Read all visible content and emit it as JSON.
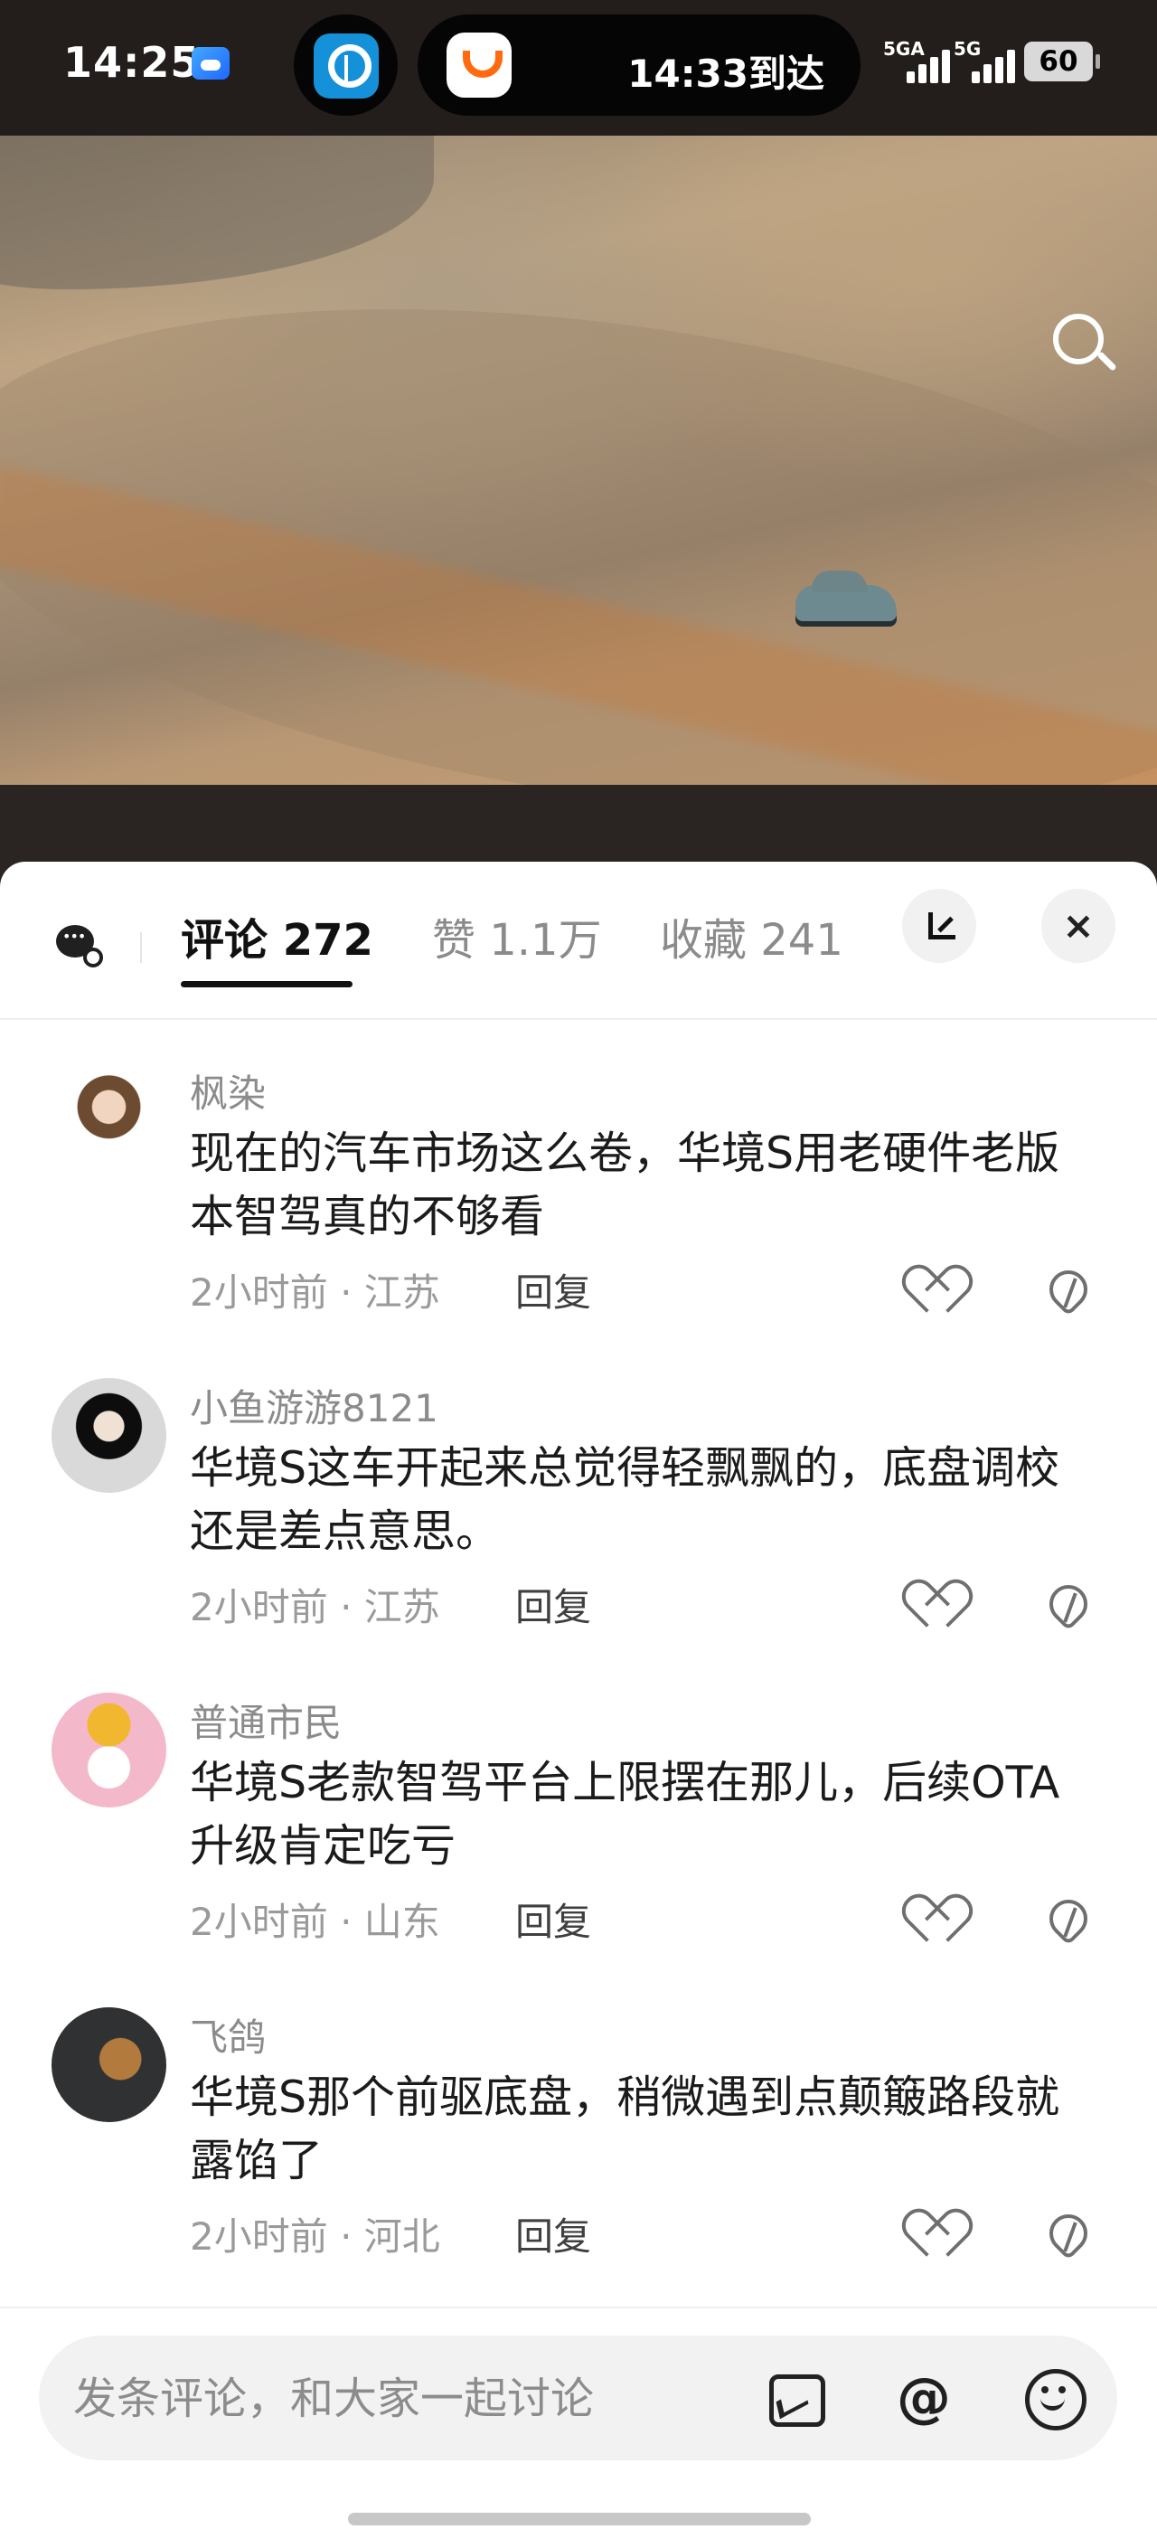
{
  "status_bar": {
    "time": "14:25",
    "arrival": "14:33到达",
    "network_1": "5GA",
    "network_2": "5G",
    "battery": "60",
    "icons": [
      "weather-icon",
      "railway-app-icon",
      "didi-app-icon",
      "signal-icon",
      "battery-icon"
    ]
  },
  "video": {
    "icons": [
      "search-icon"
    ]
  },
  "comment_panel": {
    "tabs": [
      {
        "label": "评论 272",
        "active": true
      },
      {
        "label": "赞 1.1万",
        "active": false
      },
      {
        "label": "收藏 241",
        "active": false
      }
    ],
    "icons": [
      "ai-chat-icon",
      "expand-icon",
      "close-icon"
    ]
  },
  "comments": [
    {
      "name": "枫染",
      "text": "现在的汽车市场这么卷，华境S用老硬件老版本智驾真的不够看",
      "time_location": "2小时前 · 江苏",
      "reply": "回复"
    },
    {
      "name": "小鱼游游8121",
      "text": "华境S这车开起来总觉得轻飘飘的，底盘调校还是差点意思。",
      "time_location": "2小时前 · 江苏",
      "reply": "回复"
    },
    {
      "name": "普通市民",
      "text": "华境S老款智驾平台上限摆在那儿，后续OTA升级肯定吃亏",
      "time_location": "2小时前 · 山东",
      "reply": "回复"
    },
    {
      "name": "飞鸽",
      "text": "华境S那个前驱底盘，稍微遇到点颠簸路段就露馅了",
      "time_location": "2小时前 · 河北",
      "reply": "回复"
    }
  ],
  "comment_input": {
    "placeholder": "发条评论，和大家一起讨论",
    "value": ""
  },
  "bottom_actions": {
    "mention": "@",
    "icons": [
      "image-icon",
      "mention-icon",
      "emoji-icon"
    ]
  },
  "colors": {
    "status_background": "#231d1b",
    "panel_background": "#ffffff",
    "primary_text": "#1b1b1b",
    "secondary_text": "#8b8b8b",
    "input_background": "#f2f2f2"
  }
}
